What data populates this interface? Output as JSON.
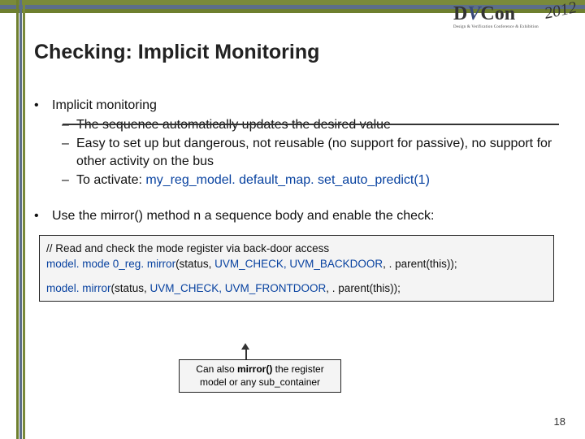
{
  "logo": {
    "prefix": "D",
    "mid": "V",
    "suffix": "Con",
    "year": "2012",
    "subtitle": "Design & Verification Conference & Exhibition"
  },
  "title": "Checking: Implicit Monitoring",
  "bullets": {
    "b1": {
      "label": "Implicit monitoring",
      "s1": "The sequence automatically updates the desired value",
      "s2": "Easy to set up but dangerous, not reusable (no support for passive), no support for other activity on the bus",
      "s3_prefix": "To activate: ",
      "s3_code": "my_reg_model. default_map. set_auto_predict(1)"
    },
    "b2": {
      "label": "Use the mirror() method n a sequence body and enable the check:"
    }
  },
  "code": {
    "comment": "// Read and check the mode register via back-door access",
    "l1a": "model. mode 0_reg. mirror",
    "l1b": "(status, ",
    "l1c": "UVM_CHECK, UVM_BACKDOOR",
    "l1d": ", . parent(this));",
    "l2a": "model. mirror",
    "l2b": "(status, ",
    "l2c": "UVM_CHECK, UVM_FRONTDOOR",
    "l2d": ", . parent(this));"
  },
  "callout": {
    "line1_a": "Can also ",
    "line1_b": "mirror()",
    "line1_c": " the register",
    "line2": "model or any sub_container"
  },
  "page": "18"
}
